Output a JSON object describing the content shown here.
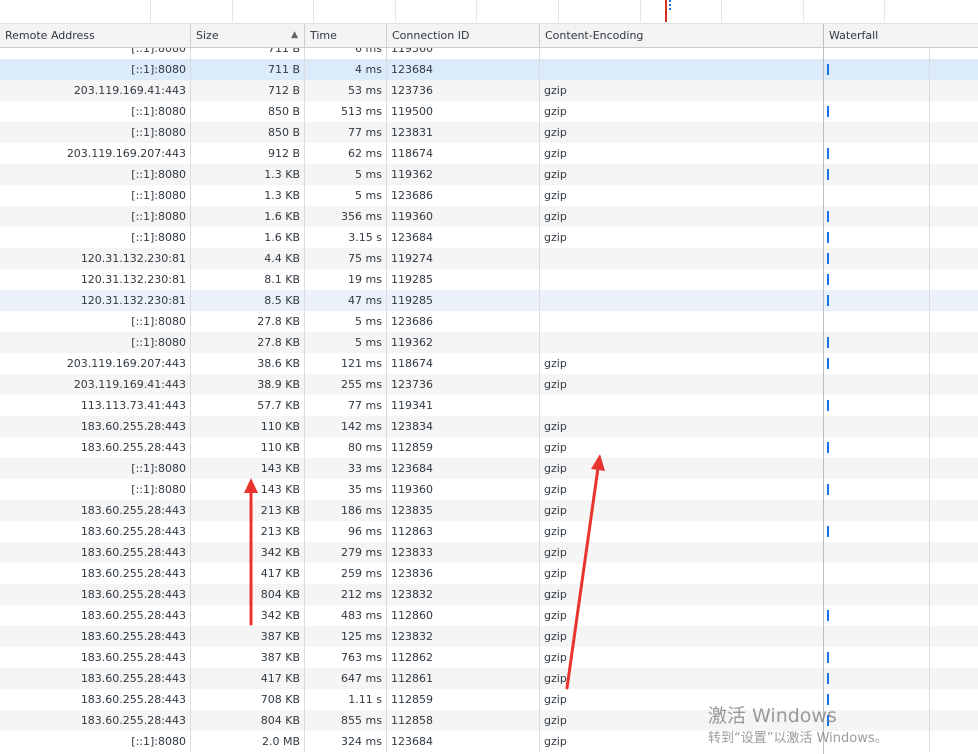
{
  "header": {
    "columns": [
      {
        "label": "Remote Address"
      },
      {
        "label": "Size"
      },
      {
        "label": "Time"
      },
      {
        "label": "Connection ID"
      },
      {
        "label": "Content-Encoding"
      },
      {
        "label": "Waterfall"
      }
    ],
    "sort_indicator": "▲"
  },
  "partial_row": {
    "address": "[::1]:8080",
    "size": "711 B",
    "time": "6 ms",
    "connection": "119360",
    "encoding": ""
  },
  "rows": [
    {
      "address": "[::1]:8080",
      "size": "711 B",
      "time": "4 ms",
      "connection": "123684",
      "encoding": "",
      "bar": true
    },
    {
      "address": "203.119.169.41:443",
      "size": "712 B",
      "time": "53 ms",
      "connection": "123736",
      "encoding": "gzip",
      "bar": false
    },
    {
      "address": "[::1]:8080",
      "size": "850 B",
      "time": "513 ms",
      "connection": "119500",
      "encoding": "gzip",
      "bar": true
    },
    {
      "address": "[::1]:8080",
      "size": "850 B",
      "time": "77 ms",
      "connection": "123831",
      "encoding": "gzip",
      "bar": false
    },
    {
      "address": "203.119.169.207:443",
      "size": "912 B",
      "time": "62 ms",
      "connection": "118674",
      "encoding": "gzip",
      "bar": true
    },
    {
      "address": "[::1]:8080",
      "size": "1.3 KB",
      "time": "5 ms",
      "connection": "119362",
      "encoding": "gzip",
      "bar": true
    },
    {
      "address": "[::1]:8080",
      "size": "1.3 KB",
      "time": "5 ms",
      "connection": "123686",
      "encoding": "gzip",
      "bar": false
    },
    {
      "address": "[::1]:8080",
      "size": "1.6 KB",
      "time": "356 ms",
      "connection": "119360",
      "encoding": "gzip",
      "bar": true
    },
    {
      "address": "[::1]:8080",
      "size": "1.6 KB",
      "time": "3.15 s",
      "connection": "123684",
      "encoding": "gzip",
      "bar": true
    },
    {
      "address": "120.31.132.230:81",
      "size": "4.4 KB",
      "time": "75 ms",
      "connection": "119274",
      "encoding": "",
      "bar": true
    },
    {
      "address": "120.31.132.230:81",
      "size": "8.1 KB",
      "time": "19 ms",
      "connection": "119285",
      "encoding": "",
      "bar": true
    },
    {
      "address": "120.31.132.230:81",
      "size": "8.5 KB",
      "time": "47 ms",
      "connection": "119285",
      "encoding": "",
      "bar": true
    },
    {
      "address": "[::1]:8080",
      "size": "27.8 KB",
      "time": "5 ms",
      "connection": "123686",
      "encoding": "",
      "bar": false
    },
    {
      "address": "[::1]:8080",
      "size": "27.8 KB",
      "time": "5 ms",
      "connection": "119362",
      "encoding": "",
      "bar": true
    },
    {
      "address": "203.119.169.207:443",
      "size": "38.6 KB",
      "time": "121 ms",
      "connection": "118674",
      "encoding": "gzip",
      "bar": true
    },
    {
      "address": "203.119.169.41:443",
      "size": "38.9 KB",
      "time": "255 ms",
      "connection": "123736",
      "encoding": "gzip",
      "bar": false
    },
    {
      "address": "113.113.73.41:443",
      "size": "57.7 KB",
      "time": "77 ms",
      "connection": "119341",
      "encoding": "",
      "bar": true
    },
    {
      "address": "183.60.255.28:443",
      "size": "110 KB",
      "time": "142 ms",
      "connection": "123834",
      "encoding": "gzip",
      "bar": false
    },
    {
      "address": "183.60.255.28:443",
      "size": "110 KB",
      "time": "80 ms",
      "connection": "112859",
      "encoding": "gzip",
      "bar": true
    },
    {
      "address": "[::1]:8080",
      "size": "143 KB",
      "time": "33 ms",
      "connection": "123684",
      "encoding": "gzip",
      "bar": false
    },
    {
      "address": "[::1]:8080",
      "size": "143 KB",
      "time": "35 ms",
      "connection": "119360",
      "encoding": "gzip",
      "bar": true
    },
    {
      "address": "183.60.255.28:443",
      "size": "213 KB",
      "time": "186 ms",
      "connection": "123835",
      "encoding": "gzip",
      "bar": false
    },
    {
      "address": "183.60.255.28:443",
      "size": "213 KB",
      "time": "96 ms",
      "connection": "112863",
      "encoding": "gzip",
      "bar": true
    },
    {
      "address": "183.60.255.28:443",
      "size": "342 KB",
      "time": "279 ms",
      "connection": "123833",
      "encoding": "gzip",
      "bar": false
    },
    {
      "address": "183.60.255.28:443",
      "size": "417 KB",
      "time": "259 ms",
      "connection": "123836",
      "encoding": "gzip",
      "bar": false
    },
    {
      "address": "183.60.255.28:443",
      "size": "804 KB",
      "time": "212 ms",
      "connection": "123832",
      "encoding": "gzip",
      "bar": false
    },
    {
      "address": "183.60.255.28:443",
      "size": "342 KB",
      "time": "483 ms",
      "connection": "112860",
      "encoding": "gzip",
      "bar": true
    },
    {
      "address": "183.60.255.28:443",
      "size": "387 KB",
      "time": "125 ms",
      "connection": "123832",
      "encoding": "gzip",
      "bar": false
    },
    {
      "address": "183.60.255.28:443",
      "size": "387 KB",
      "time": "763 ms",
      "connection": "112862",
      "encoding": "gzip",
      "bar": true
    },
    {
      "address": "183.60.255.28:443",
      "size": "417 KB",
      "time": "647 ms",
      "connection": "112861",
      "encoding": "gzip",
      "bar": true
    },
    {
      "address": "183.60.255.28:443",
      "size": "708 KB",
      "time": "1.11 s",
      "connection": "112859",
      "encoding": "gzip",
      "bar": true
    },
    {
      "address": "183.60.255.28:443",
      "size": "804 KB",
      "time": "855 ms",
      "connection": "112858",
      "encoding": "gzip",
      "bar": true
    },
    {
      "address": "[::1]:8080",
      "size": "2.0 MB",
      "time": "324 ms",
      "connection": "123684",
      "encoding": "gzip",
      "bar": false
    }
  ],
  "watermark": {
    "title": "激活 Windows",
    "subtitle": "转到“设置”以激活 Windows。"
  },
  "colors": {
    "selected_row": "#dcebfa",
    "hover_row": "#eaf1fb",
    "waterfall_bar": "#1a73e8",
    "annotation_arrow": "#e8342f"
  }
}
